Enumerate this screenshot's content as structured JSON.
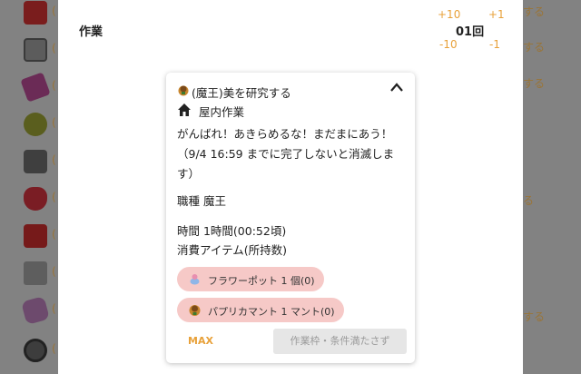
{
  "background_list": {
    "paren": "(",
    "rows": [
      {
        "icon": "red-item-icon",
        "suffix": "する"
      },
      {
        "icon": "skull-plate-icon",
        "suffix": "する"
      },
      {
        "icon": "card-item-icon",
        "suffix": "する"
      },
      {
        "icon": "cake-item-icon",
        "suffix": ""
      },
      {
        "icon": "furnace-item-icon",
        "suffix": ""
      },
      {
        "icon": "potion-item-icon",
        "suffix": "る"
      },
      {
        "icon": "red-beast-icon",
        "suffix": ""
      },
      {
        "icon": "barrel-item-icon",
        "suffix": ""
      },
      {
        "icon": "pillow-item-icon",
        "suffix": "する"
      },
      {
        "icon": "wheel-item-icon",
        "suffix": ""
      }
    ]
  },
  "panel": {
    "title": "作業",
    "count": "01回",
    "plus10": "+10",
    "plus1": "+1",
    "minus10": "-10",
    "minus1": "-1"
  },
  "card": {
    "task": "(魔王)美を研究する",
    "location": "屋内作業",
    "message": "がんばれ！あきらめるな！まだまにあう！（9/4 16:59 までに完了しないと消滅します）",
    "job": "職種 魔王",
    "time": "時間 1時間(00:52頃)",
    "consumables_label": "消費アイテム(所持数)",
    "items": [
      {
        "label": "フラワーポット 1 個(0)",
        "icon": "flower-pot-icon"
      },
      {
        "label": "パプリカマント 1 マント(0)",
        "icon": "paprika-mantle-icon"
      }
    ],
    "max_label": "MAX",
    "action_label": "作業枠・条件満たさず"
  },
  "colors": {
    "accent": "#e8a13a",
    "pill": "#f6c9c7",
    "overlay": "#828282"
  }
}
